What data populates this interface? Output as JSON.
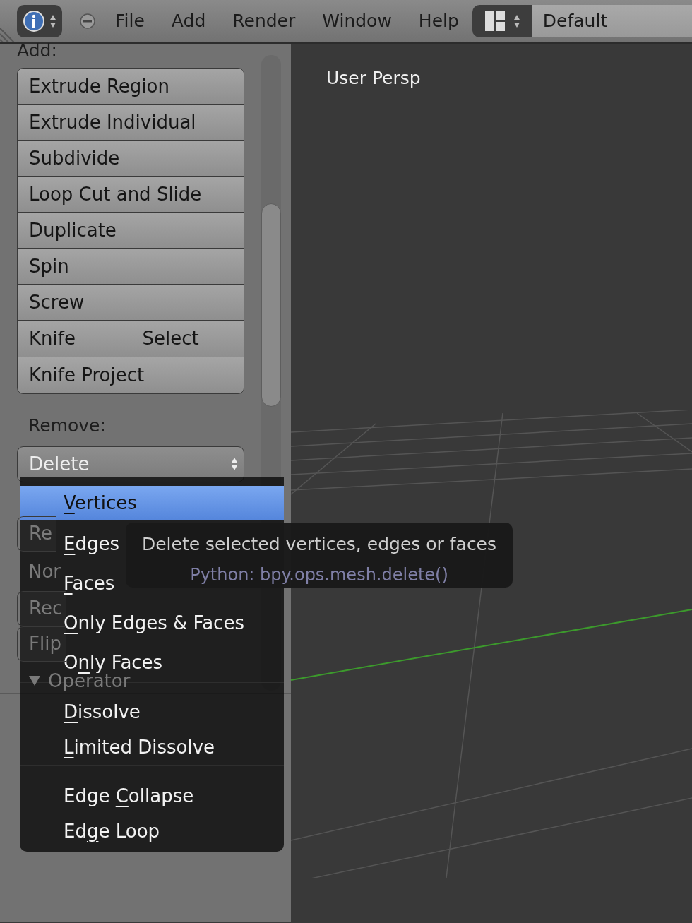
{
  "header": {
    "menus": [
      "File",
      "Add",
      "Render",
      "Window",
      "Help"
    ],
    "screen_layout": "Default"
  },
  "tool_panel": {
    "add_label": "Add:",
    "add_buttons": [
      [
        {
          "label": "Extrude Region"
        }
      ],
      [
        {
          "label": "Extrude Individual"
        }
      ],
      [
        {
          "label": "Subdivide"
        }
      ],
      [
        {
          "label": "Loop Cut and Slide"
        }
      ],
      [
        {
          "label": "Duplicate"
        }
      ],
      [
        {
          "label": "Spin"
        }
      ],
      [
        {
          "label": "Screw"
        }
      ],
      [
        {
          "label": "Knife"
        },
        {
          "label": "Select"
        }
      ],
      [
        {
          "label": "Knife Project"
        }
      ]
    ],
    "remove_label": "Remove:",
    "delete_dropdown": "Delete",
    "covered_rows": [
      {
        "kind": "button",
        "text": "Re"
      },
      {
        "kind": "label",
        "text": "Nor"
      },
      {
        "kind": "button",
        "text": "Rec"
      },
      {
        "kind": "button",
        "text": "Flip"
      }
    ],
    "operator_header": "Operator"
  },
  "viewport": {
    "label": "User Persp"
  },
  "delete_menu": {
    "groups": [
      [
        {
          "key": "V",
          "post": "ertices",
          "selected": true
        },
        {
          "key": "E",
          "post": "dges",
          "selected": false
        },
        {
          "key": "F",
          "post": "aces",
          "selected": false
        },
        {
          "key": "O",
          "post": "nly Edges & Faces",
          "selected": false
        },
        {
          "pre": "O",
          "key": "n",
          "post": "ly Faces",
          "selected": false
        }
      ],
      [
        {
          "key": "D",
          "post": "issolve",
          "selected": false
        },
        {
          "key": "L",
          "post": "imited Dissolve",
          "selected": false
        }
      ],
      [
        {
          "pre": "Edge ",
          "key": "C",
          "post": "ollapse",
          "selected": false
        },
        {
          "pre": "Ed",
          "key": "g",
          "post": "e Loop",
          "selected": false
        }
      ]
    ]
  },
  "tooltip": {
    "description": "Delete selected vertices, edges or faces",
    "python": "Python: bpy.ops.mesh.delete()"
  }
}
